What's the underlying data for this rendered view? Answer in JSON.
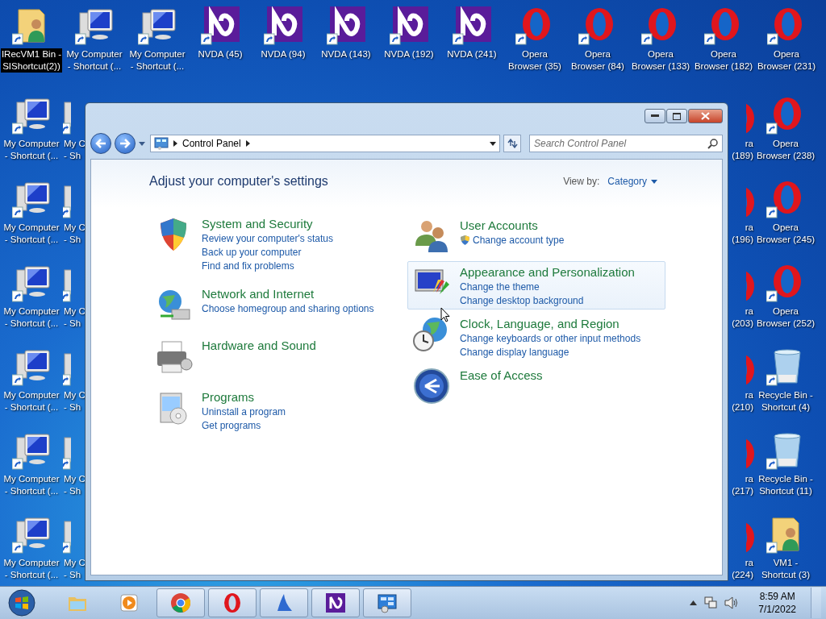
{
  "desktop": {
    "top_row": [
      {
        "kind": "user-folder",
        "label": "IRecVM1 Bin -\nSIShortcut(2))",
        "selected": true
      },
      {
        "kind": "computer",
        "label": "My Computer\n- Shortcut (...",
        "selected": false
      },
      {
        "kind": "computer",
        "label": "My Computer\n- Shortcut (...",
        "selected": false
      },
      {
        "kind": "nvda",
        "label": "NVDA (45)",
        "selected": false
      },
      {
        "kind": "nvda",
        "label": "NVDA (94)",
        "selected": false
      },
      {
        "kind": "nvda",
        "label": "NVDA (143)",
        "selected": false
      },
      {
        "kind": "nvda",
        "label": "NVDA (192)",
        "selected": false
      },
      {
        "kind": "nvda",
        "label": "NVDA (241)",
        "selected": false
      },
      {
        "kind": "opera",
        "label": "Opera\nBrowser (35)",
        "selected": false
      },
      {
        "kind": "opera",
        "label": "Opera\nBrowser (84)",
        "selected": false
      },
      {
        "kind": "opera",
        "label": "Opera\nBrowser (133)",
        "selected": false
      },
      {
        "kind": "opera",
        "label": "Opera\nBrowser (182)",
        "selected": false
      },
      {
        "kind": "opera",
        "label": "Opera\nBrowser (231)",
        "selected": false
      }
    ],
    "left_rows": [
      {
        "full": {
          "kind": "computer",
          "label": "My Computer\n- Shortcut (...",
          "selected": false
        },
        "partial": {
          "kind": "computer",
          "label": "My C\n- Sh",
          "selected": false
        }
      },
      {
        "full": {
          "kind": "computer",
          "label": "My Computer\n- Shortcut (...",
          "selected": false
        },
        "partial": {
          "kind": "computer",
          "label": "My C\n- Sh",
          "selected": false
        }
      },
      {
        "full": {
          "kind": "computer",
          "label": "My Computer\n- Shortcut (...",
          "selected": false
        },
        "partial": {
          "kind": "computer",
          "label": "My C\n- Sh",
          "selected": false
        }
      },
      {
        "full": {
          "kind": "computer",
          "label": "My Computer\n- Shortcut (...",
          "selected": false
        },
        "partial": {
          "kind": "computer",
          "label": "My C\n- Sh",
          "selected": false
        }
      },
      {
        "full": {
          "kind": "computer",
          "label": "My Computer\n- Shortcut (...",
          "selected": false
        },
        "partial": {
          "kind": "computer",
          "label": "My C\n- Sh",
          "selected": false
        }
      },
      {
        "full": {
          "kind": "computer",
          "label": "My Computer\n- Shortcut (...",
          "selected": false
        },
        "partial": {
          "kind": "computer",
          "label": "My C\n- Sh",
          "selected": false
        }
      }
    ],
    "right_rows": [
      {
        "partial": {
          "kind": "opera",
          "label": "ra\n(189)",
          "selected": false
        },
        "full": {
          "kind": "opera",
          "label": "Opera\nBrowser (238)",
          "selected": false
        }
      },
      {
        "partial": {
          "kind": "opera",
          "label": "ra\n(196)",
          "selected": false
        },
        "full": {
          "kind": "opera",
          "label": "Opera\nBrowser (245)",
          "selected": false
        }
      },
      {
        "partial": {
          "kind": "opera",
          "label": "ra\n(203)",
          "selected": false
        },
        "full": {
          "kind": "opera",
          "label": "Opera\nBrowser (252)",
          "selected": false
        }
      },
      {
        "partial": {
          "kind": "opera",
          "label": "ra\n(210)",
          "selected": false
        },
        "full": {
          "kind": "recycle",
          "label": "Recycle Bin -\nShortcut (4)",
          "selected": false
        }
      },
      {
        "partial": {
          "kind": "opera",
          "label": "ra\n(217)",
          "selected": false
        },
        "full": {
          "kind": "recycle",
          "label": "Recycle Bin -\nShortcut (11)",
          "selected": false
        }
      },
      {
        "partial": {
          "kind": "opera",
          "label": "ra\n(224)",
          "selected": false
        },
        "full": {
          "kind": "user-folder",
          "label": "VM1 -\nShortcut (3)",
          "selected": false
        }
      }
    ]
  },
  "window": {
    "breadcrumb": "Control Panel",
    "search": {
      "placeholder": "Search Control Panel"
    },
    "heading": "Adjust your computer's settings",
    "view_by": {
      "label": "View by:",
      "value": "Category"
    },
    "columns": [
      [
        {
          "kind": "security",
          "title": "System and Security",
          "hovered": false,
          "links": [
            {
              "text": "Review your computer's status",
              "shield": false
            },
            {
              "text": "Back up your computer",
              "shield": false
            },
            {
              "text": "Find and fix problems",
              "shield": false
            }
          ]
        },
        {
          "kind": "network",
          "title": "Network and Internet",
          "hovered": false,
          "links": [
            {
              "text": "Choose homegroup and sharing options",
              "shield": false
            }
          ]
        },
        {
          "kind": "hardware",
          "title": "Hardware and Sound",
          "hovered": false
        },
        {
          "kind": "programs",
          "title": "Programs",
          "hovered": false,
          "links": [
            {
              "text": "Uninstall a program",
              "shield": false
            },
            {
              "text": "Get programs",
              "shield": false
            }
          ]
        }
      ],
      [
        {
          "kind": "accounts",
          "title": "User Accounts",
          "hovered": false,
          "links": [
            {
              "text": "Change account type",
              "shield": true
            }
          ]
        },
        {
          "kind": "appearance",
          "title": "Appearance and Personalization",
          "hovered": true,
          "links": [
            {
              "text": "Change the theme",
              "shield": false
            },
            {
              "text": "Change desktop background",
              "shield": false
            }
          ]
        },
        {
          "kind": "clock",
          "title": "Clock, Language, and Region",
          "hovered": false,
          "links": [
            {
              "text": "Change keyboards or other input methods",
              "shield": false
            },
            {
              "text": "Change display language",
              "shield": false
            }
          ]
        },
        {
          "kind": "access",
          "title": "Ease of Access",
          "hovered": false
        }
      ]
    ]
  },
  "taskbar": {
    "apps": [
      {
        "kind": "explorer",
        "running": false
      },
      {
        "kind": "media",
        "running": false
      },
      {
        "kind": "chrome",
        "running": true
      },
      {
        "kind": "opera",
        "running": true
      },
      {
        "kind": "fin",
        "running": true
      },
      {
        "kind": "nvda",
        "running": true
      },
      {
        "kind": "control-panel",
        "running": true
      }
    ],
    "time": "8:59 AM",
    "date": "7/1/2022"
  }
}
